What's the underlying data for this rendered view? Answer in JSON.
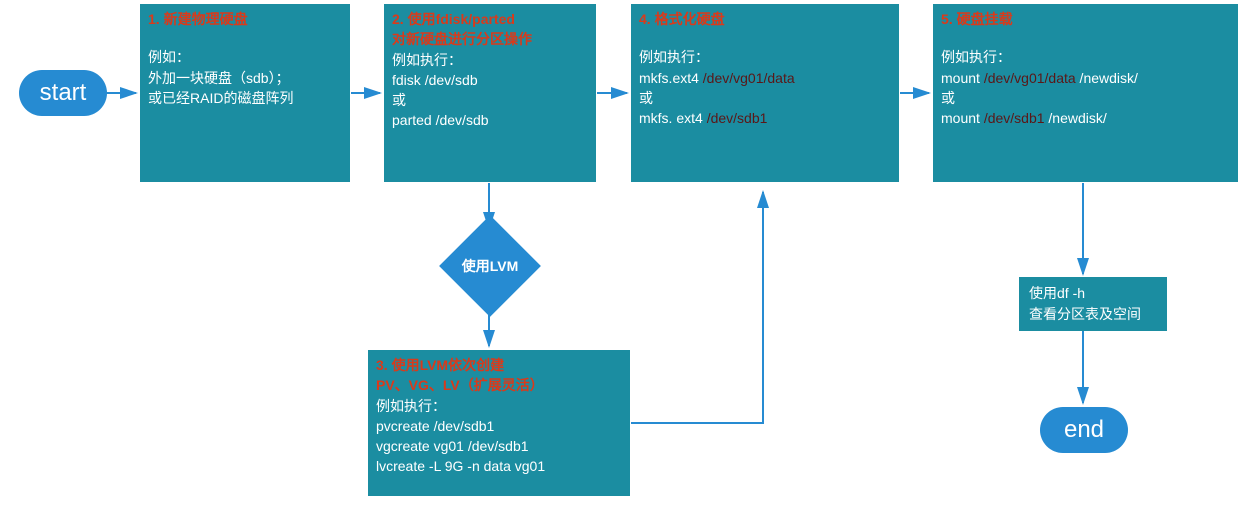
{
  "start": {
    "label": "start"
  },
  "end": {
    "label": "end"
  },
  "box1": {
    "title": "1. 新建物理硬盘",
    "line_eg": "例如：",
    "line1": "外加一块硬盘（sdb）；",
    "line2": "或已经RAID的磁盘阵列"
  },
  "box2": {
    "title_a": "2. 使用",
    "title_b": "fdisk/parted",
    "title_c": "对新硬盘进行分区操作",
    "line_eg": "例如执行：",
    "line1_a": "fdisk ",
    "line1_b": "/dev/sdb",
    "line_or": "或",
    "line2_a": "parted ",
    "line2_b": "/dev/sdb"
  },
  "decision": {
    "label": "使用LVM"
  },
  "box3": {
    "title_a": "3. 使用",
    "title_b": "LVM",
    "title_c": "依次创建",
    "title_d": "PV、VG、LV（扩展灵活）",
    "line_eg": "例如执行：",
    "line1": "pvcreate /dev/sdb1",
    "line2": "vgcreate vg01 /dev/sdb1",
    "line3": "lvcreate -L 9G -n data vg01"
  },
  "box4": {
    "title": "4. 格式化硬盘",
    "line_eg": "例如执行：",
    "line1_a": "mkfs.ext4 ",
    "line1_b": "/dev/vg01/data",
    "line_or": "或",
    "line2_a": "mkfs. ext4 ",
    "line2_b": "/dev/sdb1"
  },
  "box5": {
    "title": "5. 硬盘挂载",
    "line_eg": "例如执行：",
    "line1_a": "mount ",
    "line1_b": "/dev/vg01/data",
    "line1_c": " /newdisk/",
    "line_or": "或",
    "line2_a": "mount ",
    "line2_b": "/dev/sdb1 ",
    "line2_c": " /newdisk/"
  },
  "box6": {
    "line1": "使用df -h",
    "line2": "查看分区表及空间"
  }
}
